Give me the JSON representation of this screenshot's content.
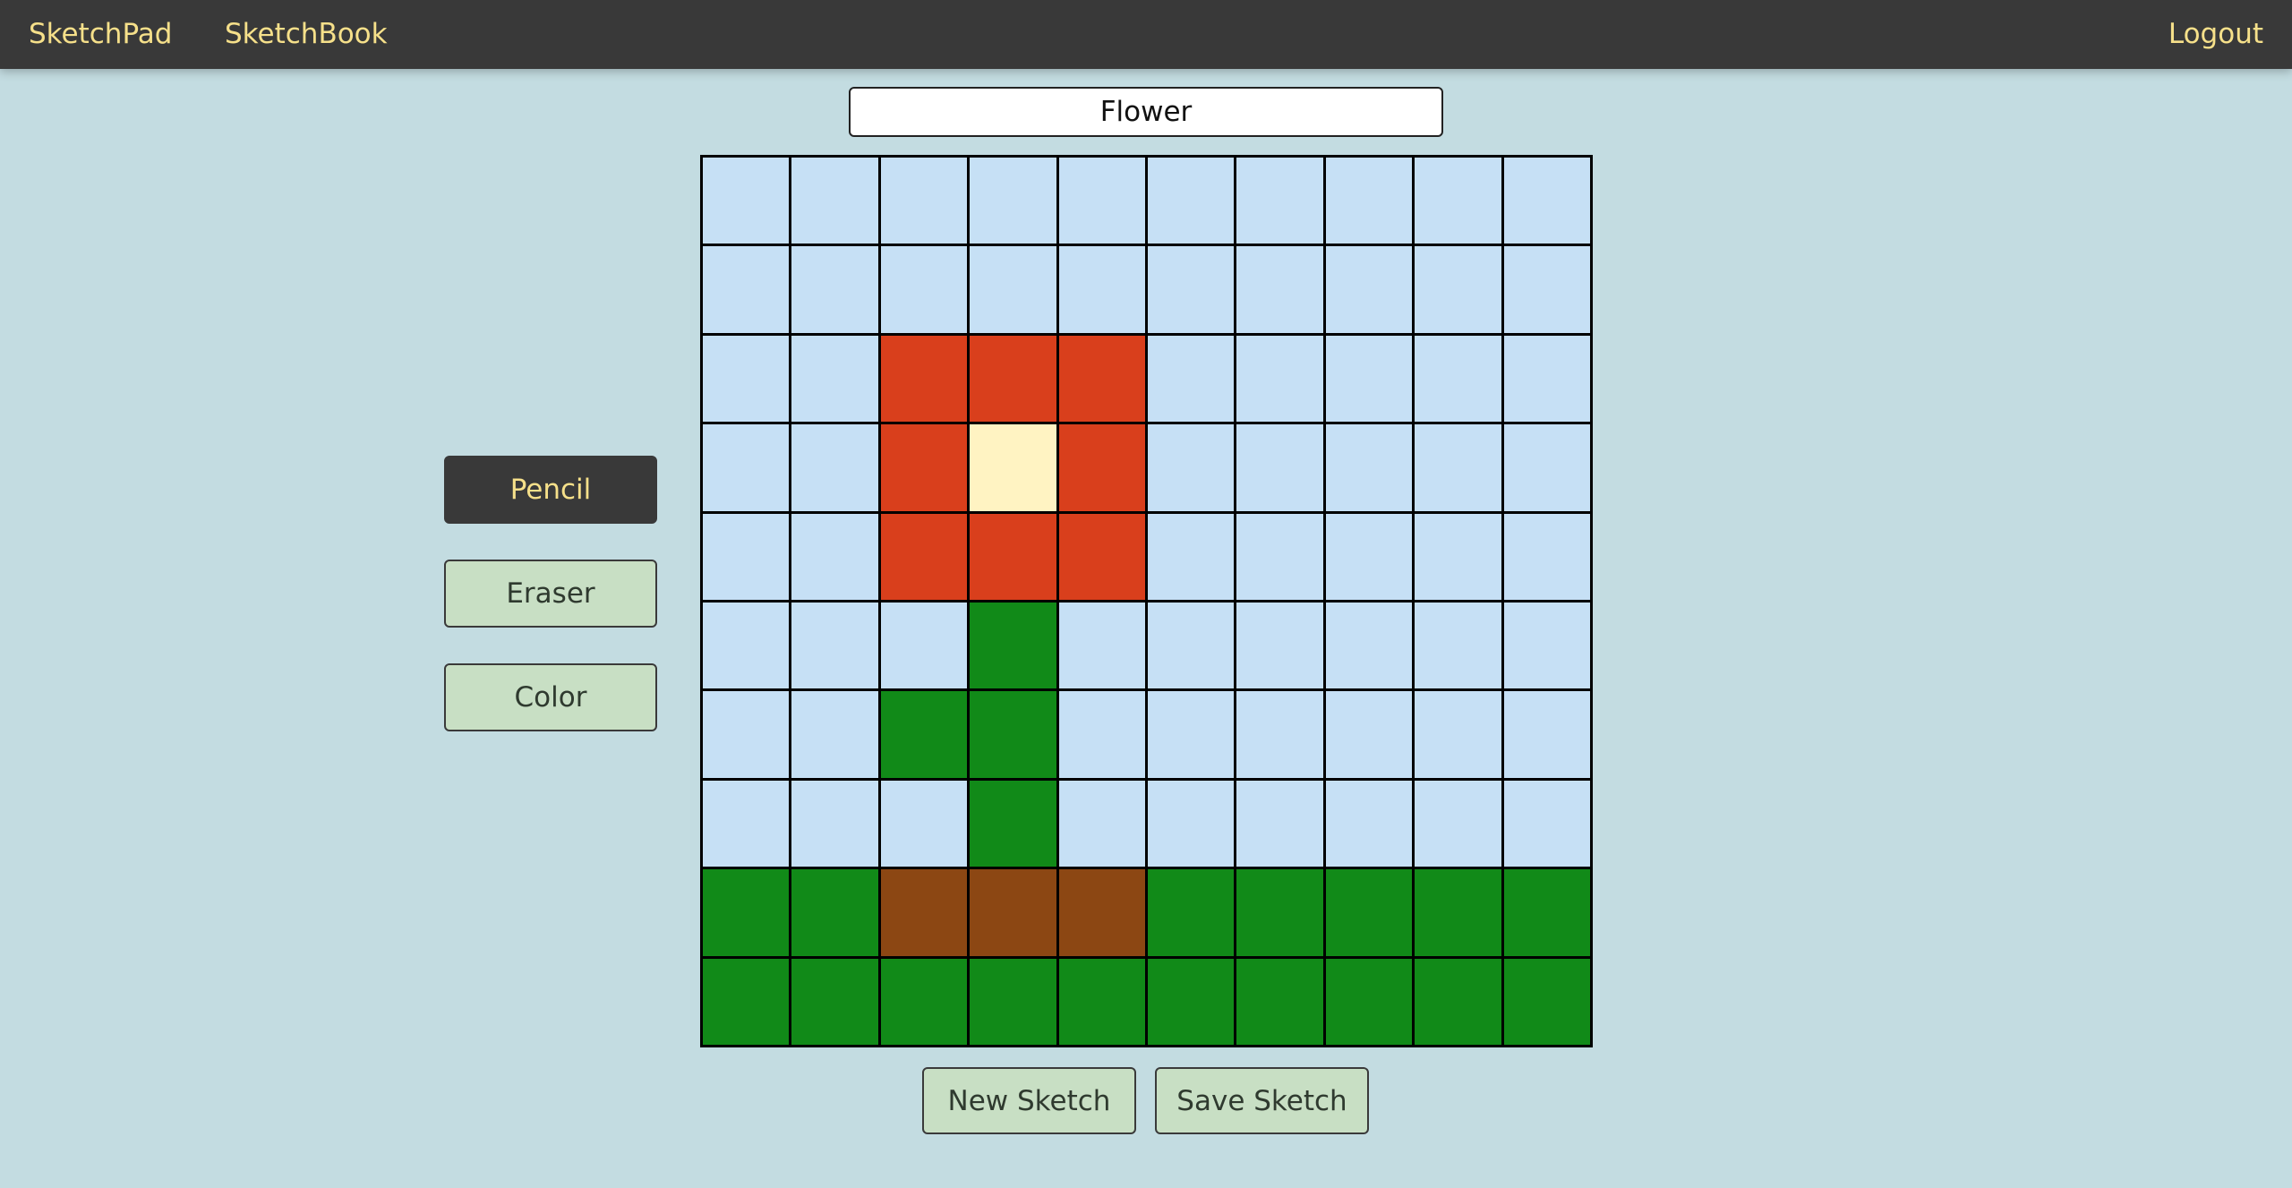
{
  "nav": {
    "sketchpad": "SketchPad",
    "sketchbook": "SketchBook",
    "logout": "Logout"
  },
  "sketch": {
    "title": "Flower"
  },
  "tools": {
    "pencil": "Pencil",
    "eraser": "Eraser",
    "color": "Color",
    "active": "pencil"
  },
  "actions": {
    "new_sketch": "New Sketch",
    "save_sketch": "Save Sketch"
  },
  "palette": {
    "s": "#c6e0f5",
    "r": "#d93f1c",
    "y": "#fff3c2",
    "g": "#118a18",
    "b": "#8c4713"
  },
  "grid": [
    [
      "s",
      "s",
      "s",
      "s",
      "s",
      "s",
      "s",
      "s",
      "s",
      "s"
    ],
    [
      "s",
      "s",
      "s",
      "s",
      "s",
      "s",
      "s",
      "s",
      "s",
      "s"
    ],
    [
      "s",
      "s",
      "r",
      "r",
      "r",
      "s",
      "s",
      "s",
      "s",
      "s"
    ],
    [
      "s",
      "s",
      "r",
      "y",
      "r",
      "s",
      "s",
      "s",
      "s",
      "s"
    ],
    [
      "s",
      "s",
      "r",
      "r",
      "r",
      "s",
      "s",
      "s",
      "s",
      "s"
    ],
    [
      "s",
      "s",
      "s",
      "g",
      "s",
      "s",
      "s",
      "s",
      "s",
      "s"
    ],
    [
      "s",
      "s",
      "g",
      "g",
      "s",
      "s",
      "s",
      "s",
      "s",
      "s"
    ],
    [
      "s",
      "s",
      "s",
      "g",
      "s",
      "s",
      "s",
      "s",
      "s",
      "s"
    ],
    [
      "g",
      "g",
      "b",
      "b",
      "b",
      "g",
      "g",
      "g",
      "g",
      "g"
    ],
    [
      "g",
      "g",
      "g",
      "g",
      "g",
      "g",
      "g",
      "g",
      "g",
      "g"
    ]
  ]
}
